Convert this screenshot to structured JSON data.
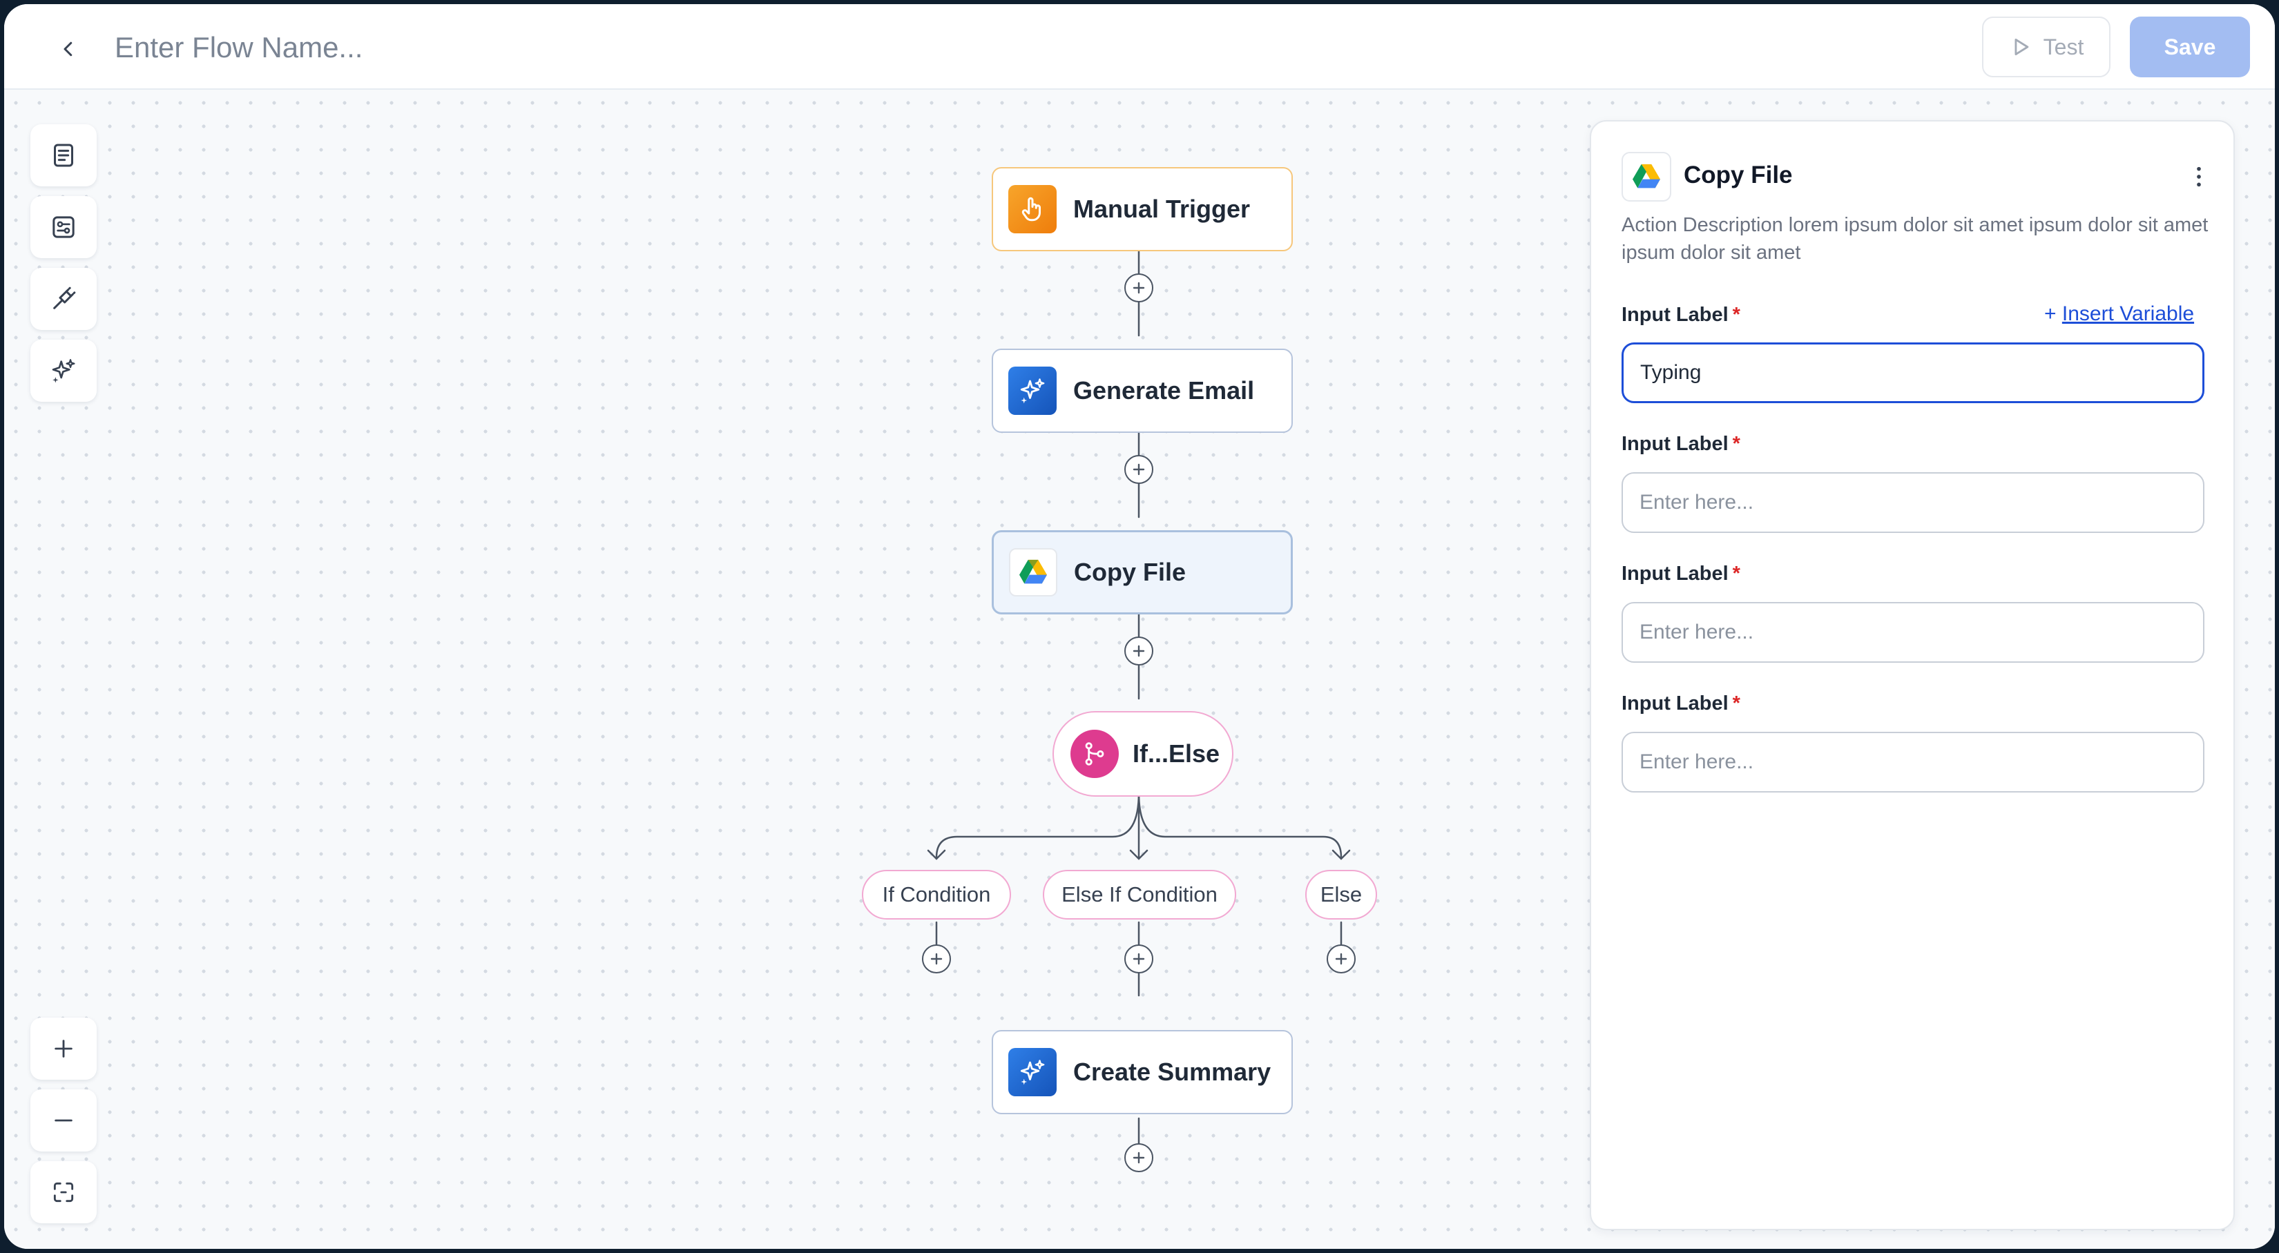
{
  "header": {
    "flow_name_placeholder": "Enter Flow Name...",
    "test_label": "Test",
    "save_label": "Save"
  },
  "toolbar": {
    "tools": [
      {
        "name": "document-icon"
      },
      {
        "name": "settings-panel-icon"
      },
      {
        "name": "plug-icon"
      },
      {
        "name": "sparkles-icon"
      }
    ],
    "zoom": [
      {
        "name": "zoom-in-icon"
      },
      {
        "name": "zoom-out-icon"
      },
      {
        "name": "fit-view-icon"
      }
    ]
  },
  "flow": {
    "nodes": [
      {
        "label": "Manual Trigger",
        "icon": "pointer-hand-icon"
      },
      {
        "label": "Generate Email",
        "icon": "sparkles-icon"
      },
      {
        "label": "Copy File",
        "icon": "google-drive-icon"
      },
      {
        "label": "If...Else",
        "icon": "branch-icon"
      },
      {
        "label": "Create Summary",
        "icon": "sparkles-icon"
      }
    ],
    "branches": [
      {
        "label": "If Condition"
      },
      {
        "label": "Else If Condition"
      },
      {
        "label": "Else"
      }
    ]
  },
  "panel": {
    "title": "Copy File",
    "description": "Action Description lorem ipsum dolor sit amet ipsum dolor sit amet ipsum dolor sit amet",
    "insert_variable_prefix": "+ ",
    "insert_variable_label": "Insert Variable",
    "required_mark": "*",
    "fields": [
      {
        "label": "Input Label",
        "value": "Typing",
        "placeholder": ""
      },
      {
        "label": "Input Label",
        "value": "",
        "placeholder": "Enter here..."
      },
      {
        "label": "Input Label",
        "value": "",
        "placeholder": "Enter here..."
      },
      {
        "label": "Input Label",
        "value": "",
        "placeholder": "Enter here..."
      }
    ]
  },
  "colors": {
    "accent": "#1d4ed8",
    "save_disabled": "#a3bdf2",
    "trigger_orange": "#f59e0b",
    "ai_blue": "#1e63d6",
    "branch_pink": "#db2777",
    "required_red": "#dc2626"
  }
}
